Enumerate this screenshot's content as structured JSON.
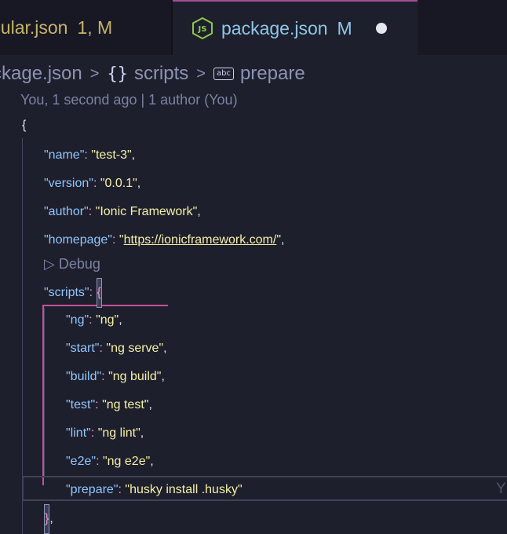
{
  "tabs": [
    {
      "name": "gular.json",
      "status": "1, M",
      "active": false
    },
    {
      "name": "package.json",
      "status": "M",
      "active": true,
      "icon": "nodejs-icon",
      "unsaved": true
    }
  ],
  "breadcrumb": {
    "file": "ckage.json",
    "sep": ">",
    "obj_symbol": "{}",
    "obj": "scripts",
    "str_symbol": "abc",
    "str": "prepare"
  },
  "blame": "You, 1 second ago | 1 author (You)",
  "codelens": "▷ Debug",
  "ghost_blame": "Y",
  "colors": {
    "key": "#8fc6ff",
    "string": "#f5f0a8",
    "punct": "#e4e6f0",
    "accent_pink": "#c7509b",
    "tab_modified": "#c8b468",
    "tab_active": "#8ec8e8"
  },
  "code": {
    "open_brace": "{",
    "name_k": "\"name\"",
    "name_v": "\"test-3\"",
    "version_k": "\"version\"",
    "version_v": "\"0.0.1\"",
    "author_k": "\"author\"",
    "author_v": "\"Ionic Framework\"",
    "homepage_k": "\"homepage\"",
    "homepage_q1": "\"",
    "homepage_url": "https://ionicframework.com/",
    "homepage_q2": "\"",
    "scripts_k": "\"scripts\"",
    "scripts_open": "{",
    "ng_k": "\"ng\"",
    "ng_v": "\"ng\"",
    "start_k": "\"start\"",
    "start_v": "\"ng serve\"",
    "build_k": "\"build\"",
    "build_v": "\"ng build\"",
    "test_k": "\"test\"",
    "test_v": "\"ng test\"",
    "lint_k": "\"lint\"",
    "lint_v": "\"ng lint\"",
    "e2e_k": "\"e2e\"",
    "e2e_v": "\"ng e2e\"",
    "prepare_k": "\"prepare\"",
    "prepare_v": "\"husky install .husky\"",
    "scripts_close": "}",
    "colon": ":",
    "comma": ","
  }
}
